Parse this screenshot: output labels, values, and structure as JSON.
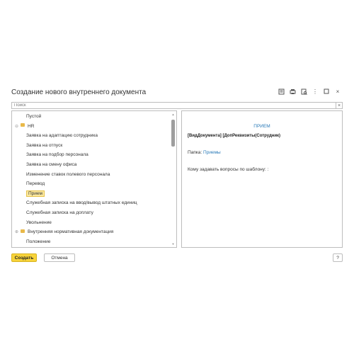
{
  "window": {
    "title": "Создание нового внутреннего документа",
    "icons": [
      "document-icon",
      "print-icon",
      "preview-icon",
      "more-icon",
      "maximize-icon",
      "close-icon"
    ]
  },
  "search": {
    "placeholder": "Поиск",
    "clear_label": "×"
  },
  "tree": {
    "items": [
      {
        "label": "Пустой",
        "level": 0,
        "folder": false
      },
      {
        "label": "HR",
        "level": 0,
        "folder": true,
        "expander": "⊖"
      },
      {
        "label": "Заявка на адаптацию сотрудника",
        "level": 1,
        "folder": false
      },
      {
        "label": "Заявка на отпуск",
        "level": 1,
        "folder": false
      },
      {
        "label": "Заявка на подбор персонала",
        "level": 1,
        "folder": false
      },
      {
        "label": "Заявка на смену офиса",
        "level": 1,
        "folder": false
      },
      {
        "label": "Изменение ставок полевого персонала",
        "level": 1,
        "folder": false
      },
      {
        "label": "Перевод",
        "level": 1,
        "folder": false
      },
      {
        "label": "Прием",
        "level": 1,
        "folder": false,
        "selected": true
      },
      {
        "label": "Служебная записка на ввод/вывод штатных единиц",
        "level": 1,
        "folder": false
      },
      {
        "label": "Служебная записка на доплату",
        "level": 1,
        "folder": false
      },
      {
        "label": "Увольнение",
        "level": 1,
        "folder": false
      },
      {
        "label": "Внутренняя нормативная документация",
        "level": 0,
        "folder": true,
        "expander": "⊕"
      },
      {
        "label": "Положение",
        "level": 1,
        "folder": false
      }
    ]
  },
  "preview": {
    "title": "ПРИЕМ",
    "vars": "[ВидДокумента] [ДопРеквизиты(Сотрудник)",
    "folder_label": "Папка: ",
    "folder_link": "Приемы",
    "ask": "Кому задавать вопросы по шаблону: :"
  },
  "buttons": {
    "create": "Создать",
    "cancel": "Отмена",
    "help": "?"
  }
}
